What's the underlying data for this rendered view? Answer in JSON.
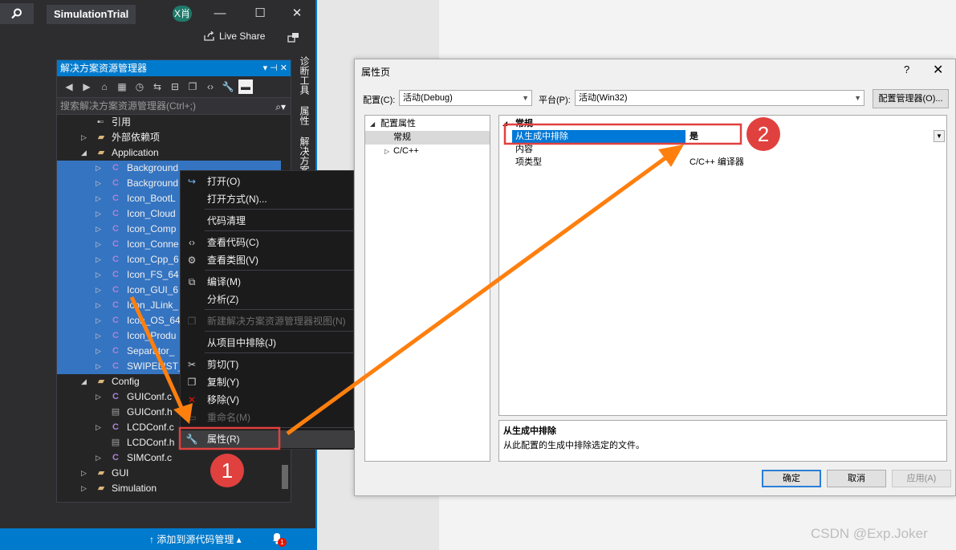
{
  "vs": {
    "solution_title": "SimulationTrial",
    "avatar": "X肖",
    "minimize": "—",
    "maximize": "☐",
    "close": "✕",
    "live_share": "Live Share",
    "side_tabs": [
      "诊断工具",
      "属性",
      "解决方案"
    ]
  },
  "solution_explorer": {
    "title": "解决方案资源管理器",
    "header_controls": "▾ ⊣ ✕",
    "search_placeholder": "搜索解决方案资源管理器(Ctrl+;)",
    "rows": [
      {
        "label": "引用",
        "icon": "references-icon",
        "kind": "ref"
      },
      {
        "label": "外部依赖项",
        "icon": "external-deps-icon",
        "kind": "folder"
      },
      {
        "label": "Application",
        "icon": "folder-icon",
        "kind": "folder"
      },
      {
        "label": "Background",
        "icon": "c-file-icon",
        "kind": "c"
      },
      {
        "label": "Background",
        "icon": "c-file-icon",
        "kind": "c"
      },
      {
        "label": "Icon_BootL",
        "icon": "c-file-icon",
        "kind": "c"
      },
      {
        "label": "Icon_Cloud",
        "icon": "c-file-icon",
        "kind": "c"
      },
      {
        "label": "Icon_Comp",
        "icon": "c-file-icon",
        "kind": "c"
      },
      {
        "label": "Icon_Conne",
        "icon": "c-file-icon",
        "kind": "c"
      },
      {
        "label": "Icon_Cpp_6",
        "icon": "c-file-icon",
        "kind": "c"
      },
      {
        "label": "Icon_FS_64",
        "icon": "c-file-icon",
        "kind": "c"
      },
      {
        "label": "Icon_GUI_6",
        "icon": "c-file-icon",
        "kind": "c"
      },
      {
        "label": "Icon_JLink_",
        "icon": "c-file-icon",
        "kind": "c"
      },
      {
        "label": "Icon_OS_64",
        "icon": "c-file-icon",
        "kind": "c"
      },
      {
        "label": "Icon_Produ",
        "icon": "c-file-icon",
        "kind": "c"
      },
      {
        "label": "Separator_",
        "icon": "c-file-icon",
        "kind": "c"
      },
      {
        "label": "SWIPELIST_",
        "icon": "c-file-icon",
        "kind": "c"
      },
      {
        "label": "Config",
        "icon": "folder-icon",
        "kind": "folder"
      },
      {
        "label": "GUIConf.c",
        "icon": "c-file-icon",
        "kind": "c"
      },
      {
        "label": "GUIConf.h",
        "icon": "h-file-icon",
        "kind": "h"
      },
      {
        "label": "LCDConf.c",
        "icon": "c-file-icon",
        "kind": "c"
      },
      {
        "label": "LCDConf.h",
        "icon": "h-file-icon",
        "kind": "h"
      },
      {
        "label": "SIMConf.c",
        "icon": "c-file-icon",
        "kind": "c"
      },
      {
        "label": "GUI",
        "icon": "folder-icon",
        "kind": "folder"
      },
      {
        "label": "Simulation",
        "icon": "folder-icon",
        "kind": "folder"
      }
    ]
  },
  "statusbar": {
    "source_control": "↑ 添加到源代码管理 ▴",
    "notification_count": "1"
  },
  "context_menu": {
    "items": [
      {
        "label": "打开(O)",
        "icon": "open-arrow-icon",
        "disabled": false
      },
      {
        "label": "打开方式(N)...",
        "icon": "",
        "disabled": false
      },
      {
        "label": "代码清理",
        "icon": "",
        "disabled": false
      },
      {
        "label": "查看代码(C)",
        "icon": "code-icon",
        "disabled": false
      },
      {
        "label": "查看类图(V)",
        "icon": "class-diagram-icon",
        "disabled": false
      },
      {
        "label": "编译(M)",
        "icon": "compile-icon",
        "disabled": false
      },
      {
        "label": "分析(Z)",
        "icon": "",
        "disabled": false
      },
      {
        "label": "新建解决方案资源管理器视图(N)",
        "icon": "new-view-icon",
        "disabled": true
      },
      {
        "label": "从项目中排除(J)",
        "icon": "",
        "disabled": false
      },
      {
        "label": "剪切(T)",
        "icon": "scissors-icon",
        "disabled": false
      },
      {
        "label": "复制(Y)",
        "icon": "copy-icon",
        "disabled": false
      },
      {
        "label": "移除(V)",
        "icon": "remove-x-icon",
        "disabled": false
      },
      {
        "label": "重命名(M)",
        "icon": "rename-icon",
        "disabled": true
      },
      {
        "label": "属性(R)",
        "icon": "wrench-icon",
        "disabled": false
      }
    ]
  },
  "dialog": {
    "title": "属性页",
    "help": "?",
    "close": "✕",
    "config_label": "配置(C):",
    "config_value": "活动(Debug)",
    "platform_label": "平台(P):",
    "platform_value": "活动(Win32)",
    "config_manager": "配置管理器(O)...",
    "tree": [
      {
        "label": "配置属性",
        "arrow": "◢"
      },
      {
        "label": "常规",
        "arrow": ""
      },
      {
        "label": "C/C++",
        "arrow": "▷"
      }
    ],
    "grid_category": "常规",
    "grid_rows": [
      {
        "name": "从生成中排除",
        "value": "是"
      },
      {
        "name": "内容",
        "value": ""
      },
      {
        "name": "项类型",
        "value": "C/C++ 编译器"
      }
    ],
    "desc_title": "从生成中排除",
    "desc_text": "从此配置的生成中排除选定的文件。",
    "ok": "确定",
    "cancel": "取消",
    "apply": "应用(A)"
  },
  "annotations": {
    "badge1": "1",
    "badge2": "2",
    "watermark": "CSDN @Exp.Joker",
    "accent": "#ff7f0e",
    "box": "#e0413e"
  }
}
